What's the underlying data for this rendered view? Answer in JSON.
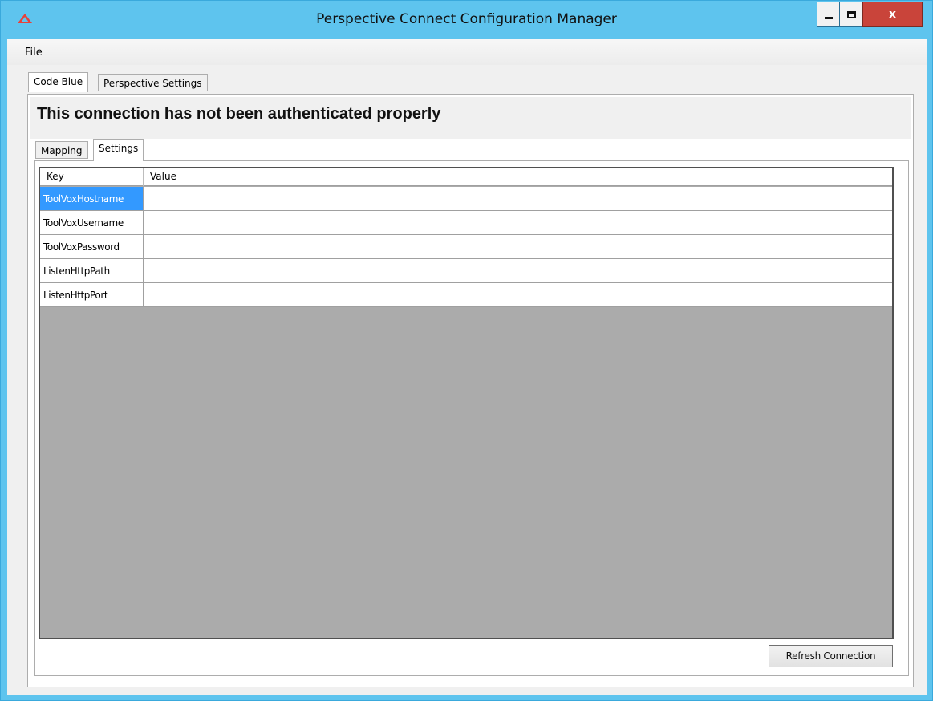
{
  "window": {
    "title": "Perspective Connect Configuration Manager",
    "close_glyph": "x",
    "accent_color": "#5ec4ee",
    "icon": "triangle-app-icon"
  },
  "menu": {
    "items": [
      {
        "label": "File"
      }
    ]
  },
  "top_tabs": [
    {
      "label": "Code Blue",
      "active": true
    },
    {
      "label": "Perspective Settings",
      "active": false
    }
  ],
  "status": {
    "message": "This connection has not been authenticated properly"
  },
  "sub_tabs": [
    {
      "label": "Mapping",
      "active": false
    },
    {
      "label": "Settings",
      "active": true
    }
  ],
  "grid": {
    "columns": {
      "key": "Key",
      "value": "Value"
    },
    "rows": [
      {
        "key": "ToolVoxHostname",
        "value": "",
        "selected": true
      },
      {
        "key": "ToolVoxUsername",
        "value": ""
      },
      {
        "key": "ToolVoxPassword",
        "value": ""
      },
      {
        "key": "ListenHttpPath",
        "value": ""
      },
      {
        "key": "ListenHttpPort",
        "value": ""
      }
    ]
  },
  "actions": {
    "refresh_label": "Refresh Connection"
  }
}
